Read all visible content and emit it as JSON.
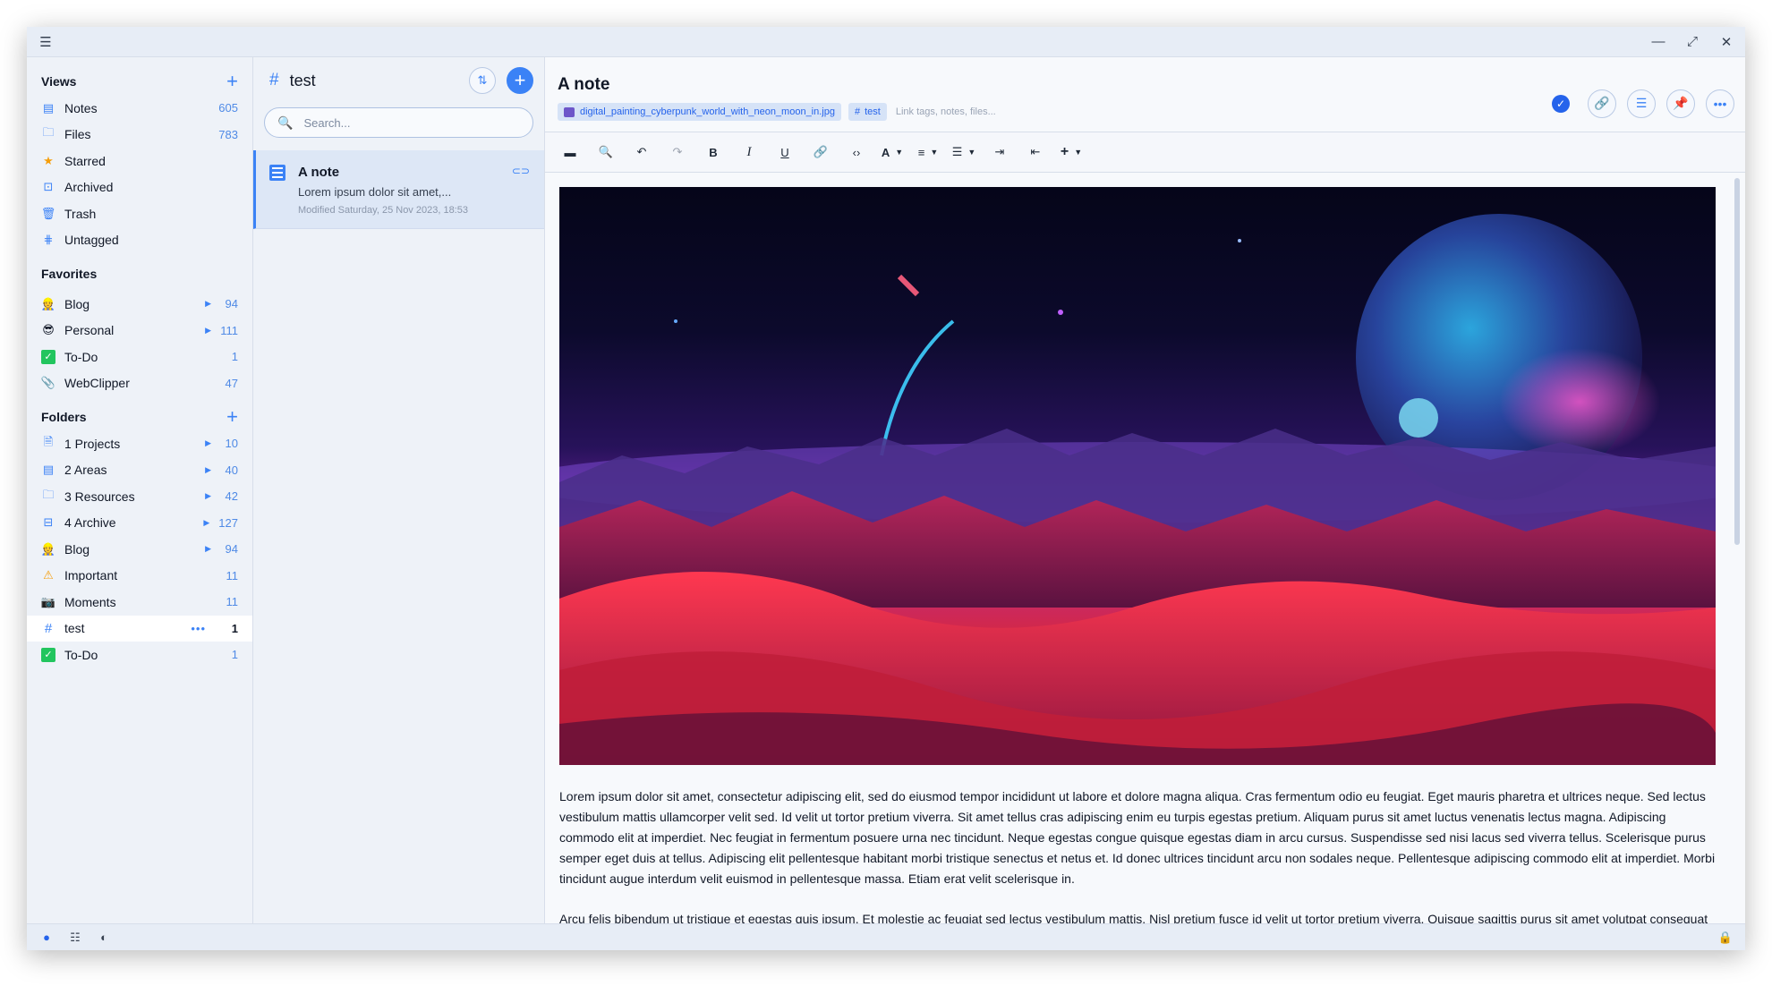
{
  "sidebar": {
    "views_heading": "Views",
    "views": [
      {
        "label": "Notes",
        "count": "605"
      },
      {
        "label": "Files",
        "count": "783"
      },
      {
        "label": "Starred",
        "count": ""
      },
      {
        "label": "Archived",
        "count": ""
      },
      {
        "label": "Trash",
        "count": ""
      },
      {
        "label": "Untagged",
        "count": ""
      }
    ],
    "favorites_heading": "Favorites",
    "favorites": [
      {
        "label": "Blog",
        "count": "94"
      },
      {
        "label": "Personal",
        "count": "111"
      },
      {
        "label": "To-Do",
        "count": "1"
      },
      {
        "label": "WebClipper",
        "count": "47"
      }
    ],
    "folders_heading": "Folders",
    "folders": [
      {
        "label": "1 Projects",
        "count": "10"
      },
      {
        "label": "2 Areas",
        "count": "40"
      },
      {
        "label": "3 Resources",
        "count": "42"
      },
      {
        "label": "4 Archive",
        "count": "127"
      },
      {
        "label": "Blog",
        "count": "94"
      },
      {
        "label": "Important",
        "count": "11"
      },
      {
        "label": "Moments",
        "count": "11"
      },
      {
        "label": "test",
        "count": "1"
      },
      {
        "label": "To-Do",
        "count": "1"
      }
    ]
  },
  "notelist": {
    "title": "test",
    "search_placeholder": "Search...",
    "notes": [
      {
        "title": "A note",
        "excerpt": "Lorem ipsum dolor sit amet,...",
        "modified": "Modified Saturday, 25 Nov 2023, 18:53"
      }
    ]
  },
  "editor": {
    "title": "A note",
    "attachment_chip": "digital_painting_cyberpunk_world_with_neon_moon_in.jpg",
    "tag_chip": "test",
    "chip_hint": "Link tags, notes, files...",
    "paragraphs": [
      "Lorem ipsum dolor sit amet, consectetur adipiscing elit, sed do eiusmod tempor incididunt ut labore et dolore magna aliqua. Cras fermentum odio eu feugiat. Eget mauris pharetra et ultrices neque. Sed lectus vestibulum mattis ullamcorper velit sed. Id velit ut tortor pretium viverra. Sit amet tellus cras adipiscing enim eu turpis egestas pretium. Aliquam purus sit amet luctus venenatis lectus magna. Adipiscing commodo elit at imperdiet. Nec feugiat in fermentum posuere urna nec tincidunt. Neque egestas congue quisque egestas diam in arcu cursus. Suspendisse sed nisi lacus sed viverra tellus. Scelerisque purus semper eget duis at tellus. Adipiscing elit pellentesque habitant morbi tristique senectus et netus et. Id donec ultrices tincidunt arcu non sodales neque. Pellentesque adipiscing commodo elit at imperdiet. Morbi tincidunt augue interdum velit euismod in pellentesque massa. Etiam erat velit scelerisque in.",
      "Arcu felis bibendum ut tristique et egestas quis ipsum. Et molestie ac feugiat sed lectus vestibulum mattis. Nisl pretium fusce id velit ut tortor pretium viverra. Quisque sagittis purus sit amet volutpat consequat mauris."
    ]
  },
  "colors": {
    "accent": "#3b82f6",
    "sidebar_bg": "#eef2f8",
    "selected_note_bg": "#dde7f6"
  }
}
